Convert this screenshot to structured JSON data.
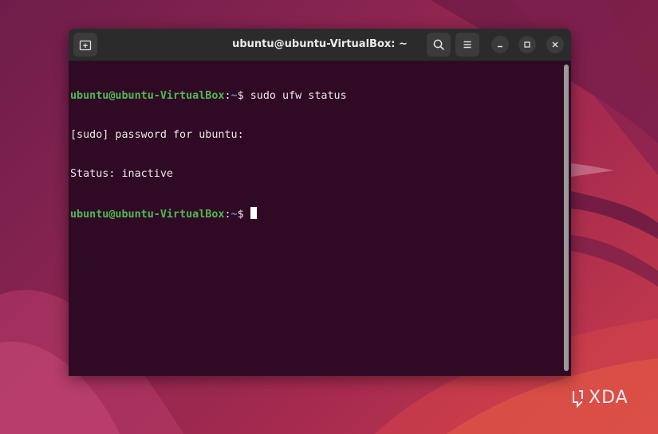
{
  "window": {
    "title": "ubuntu@ubuntu-VirtualBox: ~"
  },
  "titlebar": {
    "new_tab_icon": "new-tab-icon",
    "search_icon": "search-icon",
    "menu_icon": "hamburger-menu-icon",
    "minimize_icon": "minimize-icon",
    "maximize_icon": "maximize-icon",
    "close_icon": "close-icon"
  },
  "terminal": {
    "lines": [
      {
        "user": "ubuntu@ubuntu-VirtualBox",
        "sep": ":",
        "path": "~",
        "prompt": "$ ",
        "command": "sudo ufw status"
      },
      {
        "text": "[sudo] password for ubuntu:"
      },
      {
        "text": "Status: inactive"
      },
      {
        "user": "ubuntu@ubuntu-VirtualBox",
        "sep": ":",
        "path": "~",
        "prompt": "$ ",
        "command": ""
      }
    ]
  },
  "watermark": {
    "text": "XDA"
  },
  "colors": {
    "terminal_bg": "#300a24",
    "titlebar_bg": "#2b2b2b",
    "prompt_user": "#4fba55",
    "prompt_path": "#5b8fd8",
    "text": "#e8e8e8"
  }
}
